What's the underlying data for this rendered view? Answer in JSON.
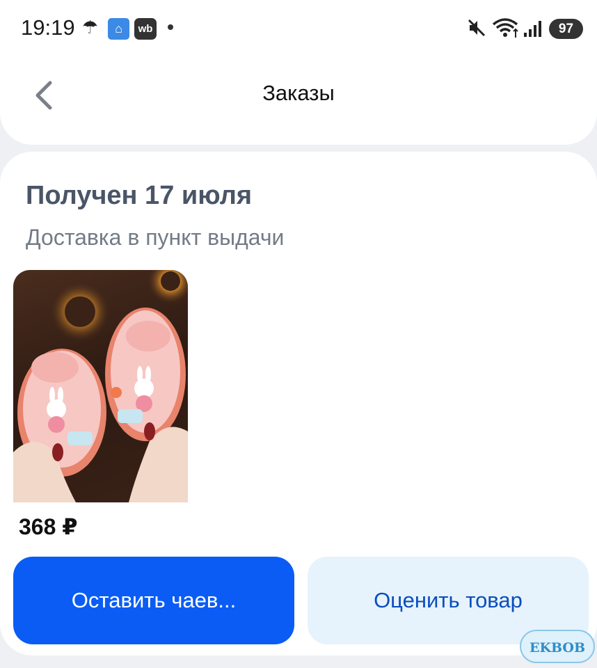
{
  "status_bar": {
    "time": "19:19",
    "wb_badge": "wb",
    "battery": "97",
    "icons": [
      "umbrella-icon",
      "home-app-icon",
      "wb-app-icon",
      "notification-dot-icon",
      "mute-icon",
      "wifi-icon",
      "signal-icon",
      "battery-icon"
    ]
  },
  "header": {
    "title": "Заказы",
    "back_icon": "chevron-left-icon"
  },
  "order": {
    "status": "Получен 17 июля",
    "delivery": "Доставка в пункт выдачи",
    "price": "368 ₽",
    "product_image": "pink children's clogs with bunny charms held in hands"
  },
  "actions": {
    "tip_label": "Оставить чаев...",
    "rate_label": "Оценить товар"
  },
  "watermark": "EKBOB",
  "colors": {
    "primary_blue": "#0a5cf5",
    "secondary_bg": "#e6f3fd",
    "secondary_text": "#0b4dbd",
    "status_title": "#4a5566"
  }
}
